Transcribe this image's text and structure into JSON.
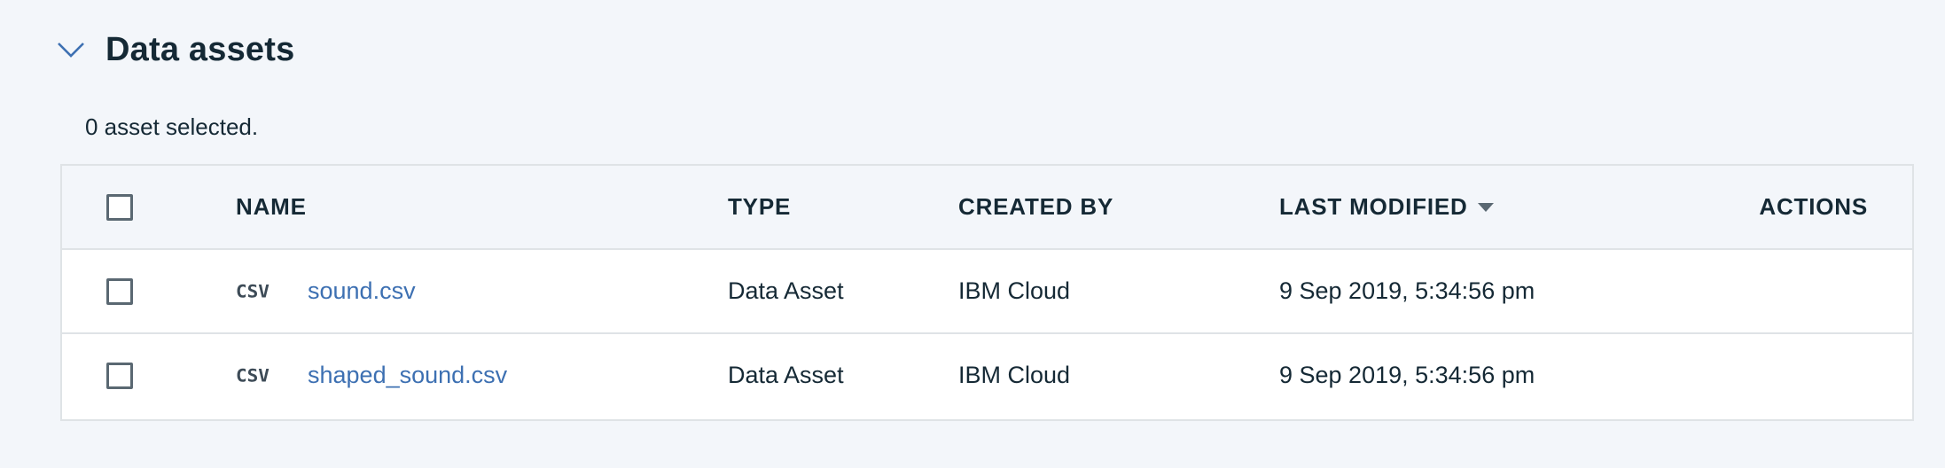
{
  "section": {
    "title": "Data assets",
    "chevron_icon": "chevron-down-icon"
  },
  "selection_status": "0 asset selected.",
  "table": {
    "columns": {
      "name": "NAME",
      "type": "TYPE",
      "created_by": "CREATED BY",
      "last_modified": "LAST MODIFIED",
      "actions": "ACTIONS"
    },
    "sort": {
      "column": "last_modified",
      "direction": "descending",
      "icon": "caret-down-icon"
    },
    "rows": [
      {
        "icon": "csv-file-icon",
        "icon_text": "CSV",
        "name": "sound.csv",
        "type": "Data Asset",
        "created_by": "IBM Cloud",
        "last_modified": "9 Sep 2019, 5:34:56 pm",
        "checked": false
      },
      {
        "icon": "csv-file-icon",
        "icon_text": "CSV",
        "name": "shaped_sound.csv",
        "type": "Data Asset",
        "created_by": "IBM Cloud",
        "last_modified": "9 Sep 2019, 5:34:56 pm",
        "checked": false
      }
    ]
  },
  "colors": {
    "link": "#3d70b2",
    "text": "#152935",
    "border": "#dfe3e6",
    "page_background": "#f3f6fa",
    "chevron": "#3d70b2"
  }
}
